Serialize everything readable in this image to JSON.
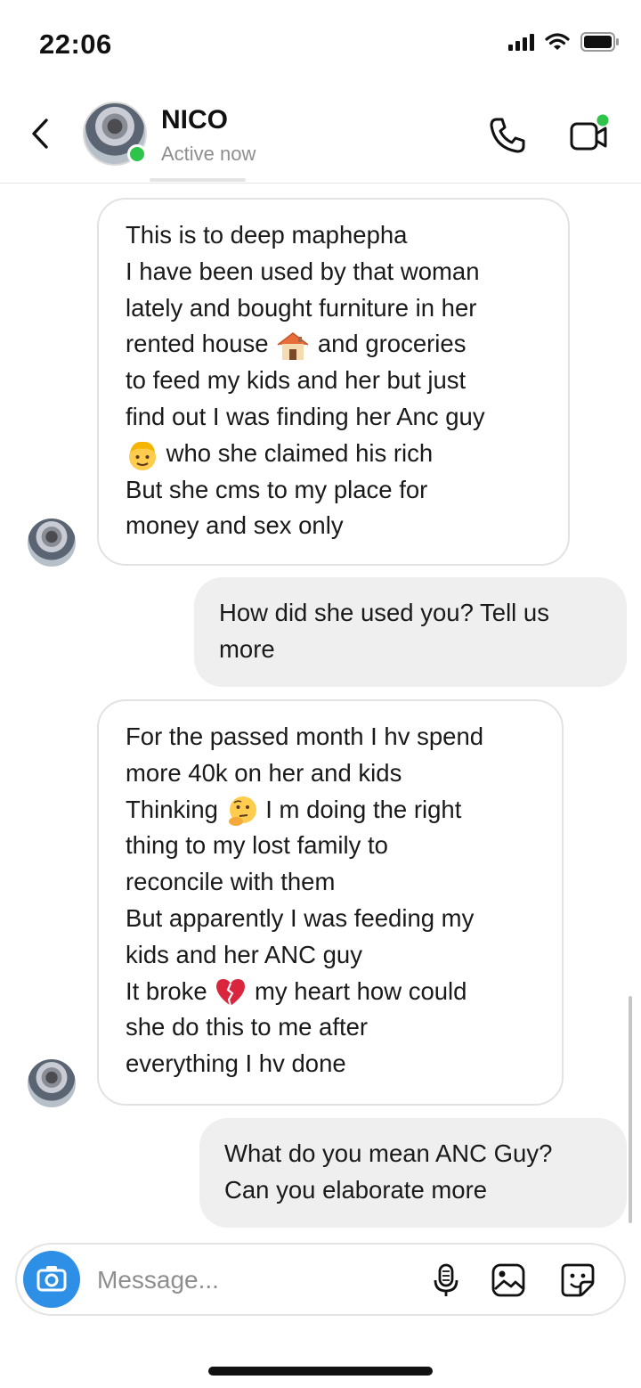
{
  "status_bar": {
    "time": "22:06",
    "icons": [
      "signal-icon",
      "wifi-icon",
      "battery-icon"
    ]
  },
  "header": {
    "name": "NICO",
    "activity": "Active now",
    "icons": [
      "back-icon",
      "phone-icon",
      "video-call-icon"
    ]
  },
  "messages": [
    {
      "direction": "incoming",
      "lines": [
        "This is to deep maphepha",
        "I have been used by that woman",
        "lately and bought furniture in her",
        {
          "before": "rented house",
          "emoji": "house",
          "after": "and groceries"
        },
        "to feed my kids and her but just",
        "find out I was finding her Anc guy",
        {
          "before": "",
          "emoji": "face",
          "after": "who she claimed his rich"
        },
        "But she cms to my place for",
        "money and sex only"
      ]
    },
    {
      "direction": "outgoing",
      "lines": [
        "How did she used you? Tell us",
        "more"
      ]
    },
    {
      "direction": "incoming",
      "lines": [
        "For the passed month I hv spend",
        "more 40k on her and kids",
        {
          "before": "Thinking",
          "emoji": "thinking",
          "after": "I m doing the right"
        },
        "thing to my lost family to",
        "reconcile with them",
        "But apparently I was feeding my",
        "kids and her ANC guy",
        {
          "before": "It broke",
          "emoji": "broken-heart",
          "after": "my heart how could"
        },
        "she do this to me after",
        "everything I hv done"
      ]
    },
    {
      "direction": "outgoing",
      "lines": [
        "What do you mean ANC Guy?",
        "Can you elaborate more"
      ]
    }
  ],
  "composer": {
    "placeholder": "Message...",
    "icons": [
      "camera-icon",
      "microphone-icon",
      "gallery-icon",
      "sticker-icon"
    ]
  },
  "colors": {
    "camera_blue": "#2d8fe6",
    "online_green": "#2ec44a",
    "outgoing_bubble": "#efefef"
  }
}
